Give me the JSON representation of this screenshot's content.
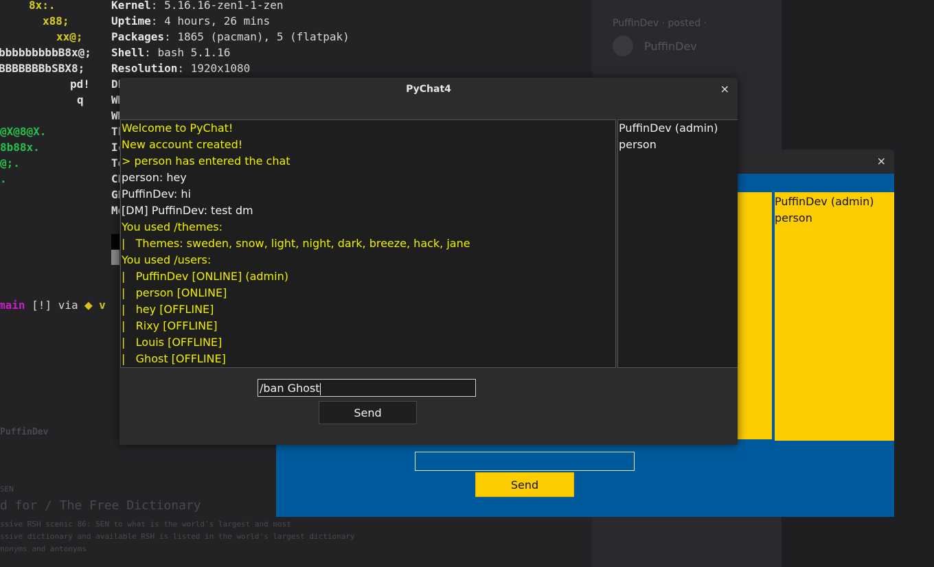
{
  "terminal": {
    "art": [
      "8x:.",
      "x88;",
      "xx@;",
      "bbbbbbbbbB8x@;",
      "BBBBBBBbSBX8;",
      "pd!",
      "q",
      "@X@8@X.",
      "8b88x.",
      "@;.",
      "."
    ],
    "info": [
      {
        "key": "Kernel",
        "value": ": 5.16.16-zen1-1-zen"
      },
      {
        "key": "Uptime",
        "value": ": 4 hours, 26 mins"
      },
      {
        "key": "Packages",
        "value": ": 1865 (pacman), 5 (flatpak)"
      },
      {
        "key": "Shell",
        "value": ": bash 5.1.16"
      },
      {
        "key": "Resolution",
        "value": ": 1920x1080"
      }
    ],
    "hidden_keys": [
      "DE",
      "WM",
      "WM",
      "Th",
      "Ic",
      "Te",
      "CP",
      "GP",
      "Me"
    ],
    "prompt": {
      "branch": "main",
      "status": "[!]",
      "via": "via",
      "plus": "⬥",
      "tail": "v"
    },
    "colors": {
      "black_block": "#000000",
      "gray_block": "#8a8a8a"
    }
  },
  "main_window": {
    "title": "PyChat4",
    "close_icon": "×",
    "messages": [
      {
        "kind": "sys",
        "text": "Welcome to PyChat!"
      },
      {
        "kind": "sys",
        "text": "New account created!"
      },
      {
        "kind": "sys",
        "text": "> person has entered the chat"
      },
      {
        "kind": "usr",
        "text": "person: hey"
      },
      {
        "kind": "usr",
        "text": "PuffinDev: hi"
      },
      {
        "kind": "usr",
        "text": "[DM] PuffinDev: test dm"
      },
      {
        "kind": "sys",
        "text": "You used /themes:"
      },
      {
        "kind": "sys",
        "text": "|   Themes: sweden, snow, light, night, dark, breeze, hack, jane"
      },
      {
        "kind": "sys",
        "text": "You used /users:"
      },
      {
        "kind": "sys",
        "text": "|   PuffinDev [ONLINE] (admin)"
      },
      {
        "kind": "sys",
        "text": "|   person [ONLINE]"
      },
      {
        "kind": "sys",
        "text": "|   hey [OFFLINE]"
      },
      {
        "kind": "sys",
        "text": "|   Rixy [OFFLINE]"
      },
      {
        "kind": "sys",
        "text": "|   Louis [OFFLINE]"
      },
      {
        "kind": "sys",
        "text": "|   Ghost [OFFLINE]"
      }
    ],
    "users": [
      "PuffinDev (admin)",
      "person"
    ],
    "input_value": "/ban Ghost",
    "send_label": "Send"
  },
  "second_window": {
    "close_icon": "×",
    "users": [
      "PuffinDev (admin)",
      "person"
    ],
    "input_value": "",
    "send_label": "Send",
    "colors": {
      "background": "#005a9c",
      "accent": "#fecd00"
    }
  },
  "background_panel": {
    "header": "PuffinDev · posted ·",
    "author": "PuffinDev"
  },
  "background_browser": {
    "heading": "d for / The Free Dictionary",
    "lines": [
      "PuffinDev",
      "SEN",
      "ssive RSH scenic 86: SEN to what is the world's largest and most",
      "ssive dictionary and available RSH is listed in the world's largest dictionary",
      "nonyms and antonyms"
    ]
  }
}
